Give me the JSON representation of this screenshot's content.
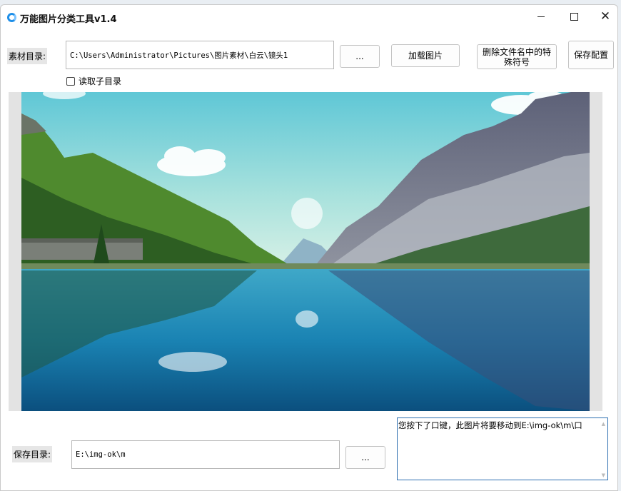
{
  "window": {
    "title": "万能图片分类工具v1.4",
    "close_symbol": "✕"
  },
  "source": {
    "label": "素材目录:",
    "path": "C:\\Users\\Administrator\\Pictures\\图片素材\\白云\\镜头1",
    "browse_label": "...",
    "load_label": "加载图片",
    "strip_special_label": "删除文件名中的特殊符号",
    "save_config_label": "保存配置",
    "subdir_checkbox_label": "读取子目录",
    "subdir_checked": false
  },
  "preview": {
    "description_icon": "landscape-image"
  },
  "save": {
    "label": "保存目录:",
    "path": "E:\\img-ok\\m",
    "browse_label": "..."
  },
  "message": {
    "text": "您按下了口键，此图片将要移动到E:\\img-ok\\m\\口"
  },
  "colors": {
    "accent": "#2d6fb0",
    "app_icon": "#1f8fe8"
  }
}
